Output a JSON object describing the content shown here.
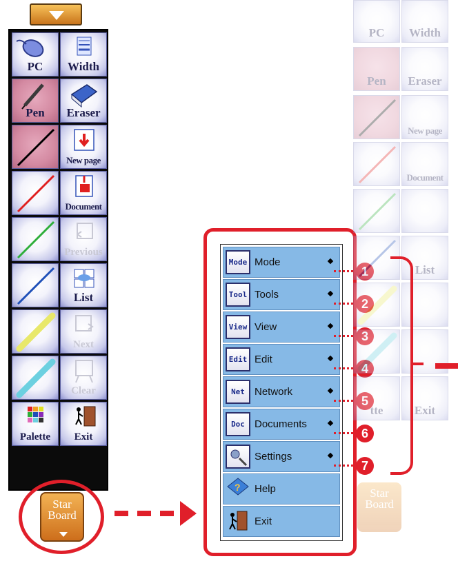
{
  "toolbar": {
    "tiles": [
      {
        "label": "PC"
      },
      {
        "label": "Width"
      },
      {
        "label": "Pen"
      },
      {
        "label": "Eraser"
      },
      {
        "label": ""
      },
      {
        "label": "New page"
      },
      {
        "label": ""
      },
      {
        "label": "Document"
      },
      {
        "label": ""
      },
      {
        "label": "Previous"
      },
      {
        "label": ""
      },
      {
        "label": "List"
      },
      {
        "label": ""
      },
      {
        "label": "Next"
      },
      {
        "label": ""
      },
      {
        "label": "Clear"
      },
      {
        "label": "Palette"
      },
      {
        "label": "Exit"
      }
    ],
    "pen_colors": [
      "#000000",
      "#e02020",
      "#2eae3a",
      "#1e4fb8",
      "#e8e86a",
      "#6cd0e0"
    ]
  },
  "starboard_button": {
    "line1": "Star",
    "line2": "Board"
  },
  "menu": {
    "items": [
      {
        "icon_text": "Mode",
        "label": "Mode",
        "submenu": true,
        "callout": "1"
      },
      {
        "icon_text": "Tool",
        "label": "Tools",
        "submenu": true,
        "callout": "2"
      },
      {
        "icon_text": "View",
        "label": "View",
        "submenu": true,
        "callout": "3"
      },
      {
        "icon_text": "Edit",
        "label": "Edit",
        "submenu": true,
        "callout": "4"
      },
      {
        "icon_text": "Net",
        "label": "Network",
        "submenu": true,
        "callout": "5"
      },
      {
        "icon_text": "Doc",
        "label": "Documents",
        "submenu": true,
        "callout": "6"
      },
      {
        "icon_text": "",
        "label": "Settings",
        "submenu": true,
        "callout": "7"
      },
      {
        "icon_text": "",
        "label": "Help",
        "submenu": false
      },
      {
        "icon_text": "",
        "label": "Exit",
        "submenu": false
      }
    ]
  },
  "ghost_toolbar": {
    "labels": [
      "PC",
      "Width",
      "Pen",
      "Eraser",
      "New page",
      "Document",
      "List",
      "tte",
      "Exit",
      "Star",
      "Board"
    ]
  },
  "colors": {
    "accent": "#e01f2a",
    "menu_item": "#86b9e6",
    "tile_border": "#5a5e9e"
  }
}
